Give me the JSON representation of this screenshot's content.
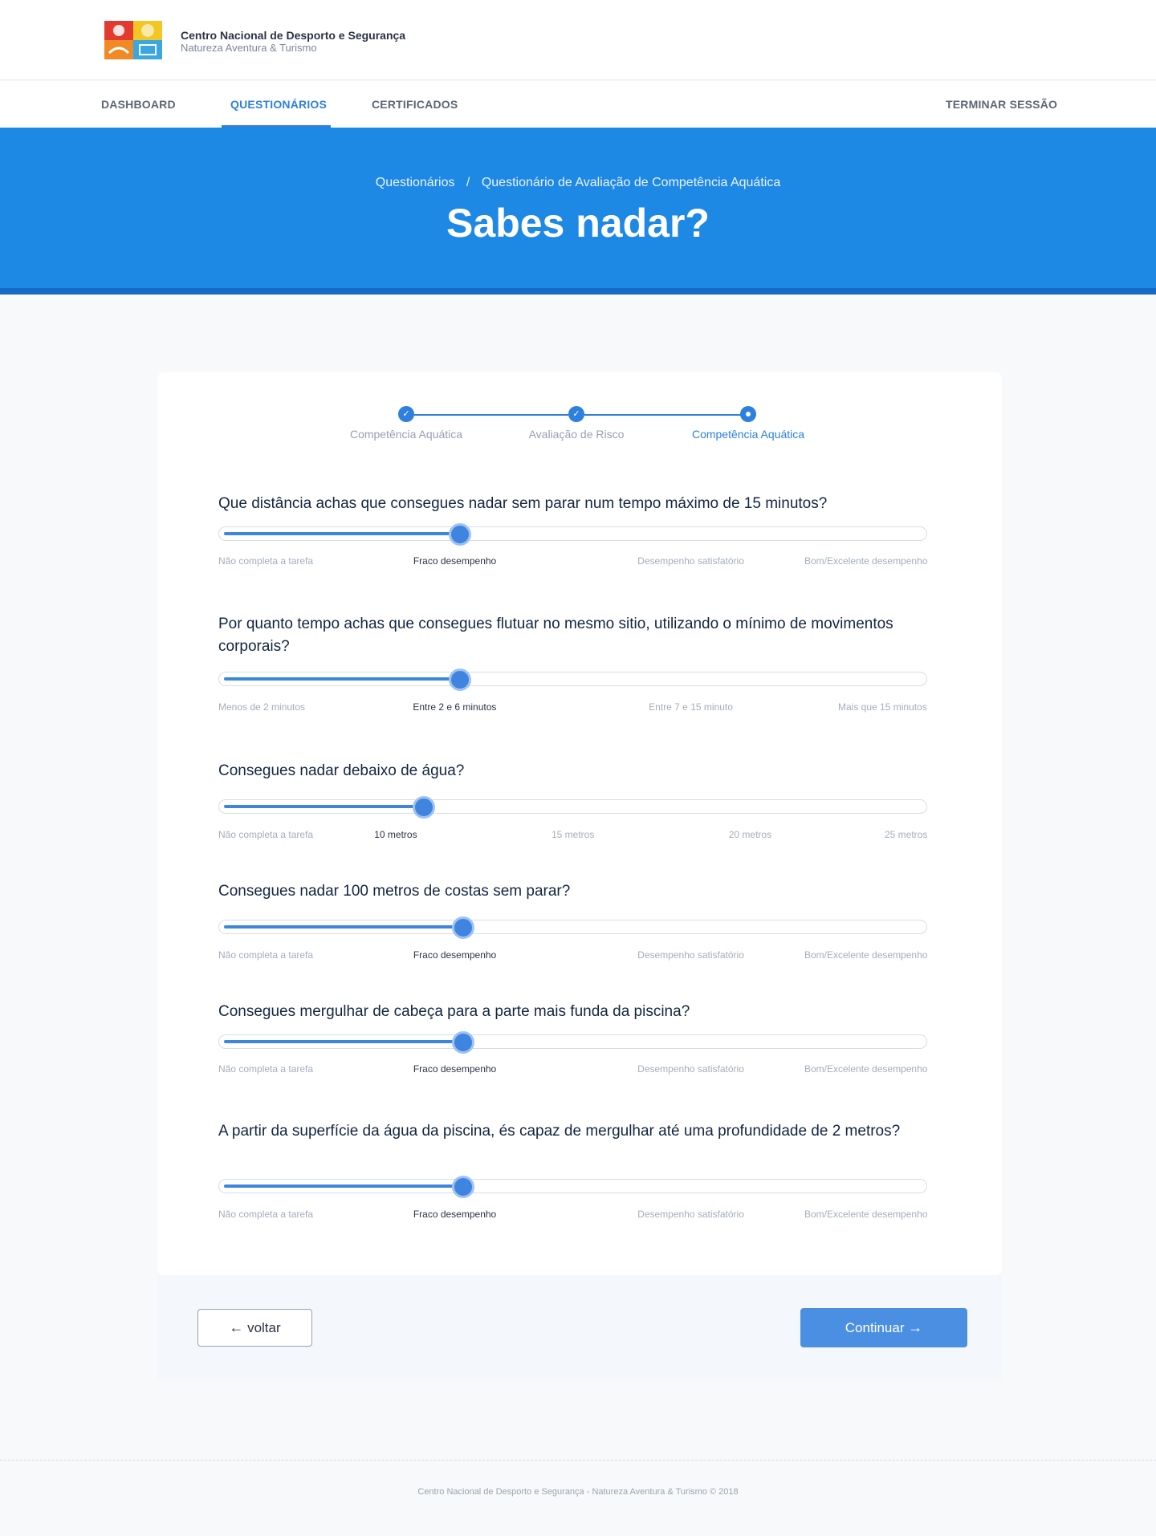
{
  "brand": {
    "name": "Centro Nacional de Desporto e Segurança",
    "subtitle": "Natureza Aventura & Turismo"
  },
  "nav": {
    "items": [
      {
        "label": "DASHBOARD",
        "active": false
      },
      {
        "label": "QUESTIONÁRIOS",
        "active": true
      },
      {
        "label": "CERTIFICADOS",
        "active": false
      }
    ],
    "logout": "TERMINAR SESSÃO"
  },
  "hero": {
    "breadcrumb": [
      "Questionários",
      "/",
      "Questionário de Avaliação de Competência Aquática"
    ],
    "title": "Sabes nadar?"
  },
  "stepper": [
    {
      "label": "Competência Aquática",
      "state": "done"
    },
    {
      "label": "Avaliação de Risco",
      "state": "done"
    },
    {
      "label": "Competência Aquática",
      "state": "current"
    }
  ],
  "questions": [
    {
      "text": "Que distância achas que consegues nadar sem parar num tempo máximo de 15 minutos?",
      "scale": [
        "Não completa a tarefa",
        "Fraco desempenho",
        "Desempenho satisfatório",
        "Bom/Excelente desempenho"
      ],
      "selected_index": 1,
      "value": 0.34
    },
    {
      "text": "Por quanto tempo achas que consegues flutuar no mesmo sitio, utilizando o mínimo de movimentos corporais?",
      "scale": [
        "Menos de 2 minutos",
        "Entre 2 e 6 minutos",
        "Entre 7 e 15 minuto",
        "Mais que 15 minutos"
      ],
      "selected_index": 1,
      "value": 0.34
    },
    {
      "text": "Consegues nadar debaixo de água?",
      "scale": [
        "Não completa a tarefa",
        "10 metros",
        "15 metros",
        "20 metros",
        "25 metros"
      ],
      "selected_index": 1,
      "value": 0.29
    },
    {
      "text": "Consegues nadar 100 metros de costas sem parar?",
      "scale": [
        "Não completa a tarefa",
        "Fraco desempenho",
        "Desempenho satisfatório",
        "Bom/Excelente desempenho"
      ],
      "selected_index": 1,
      "value": 0.345
    },
    {
      "text": "Consegues mergulhar de cabeça para a parte mais funda da piscina?",
      "scale": [
        "Não completa a tarefa",
        "Fraco desempenho",
        "Desempenho satisfatório",
        "Bom/Excelente desempenho"
      ],
      "selected_index": 1,
      "value": 0.345
    },
    {
      "text": "A partir da superfície da água da piscina, és capaz de mergulhar até uma profundidade de 2 metros?",
      "scale": [
        "Não completa a tarefa",
        "Fraco desempenho",
        "Desempenho satisfatório",
        "Bom/Excelente desempenho"
      ],
      "selected_index": 1,
      "value": 0.345
    }
  ],
  "actions": {
    "back_label": "voltar",
    "back_icon": "arrow-left-icon",
    "continue_label": "Continuar",
    "continue_icon": "arrow-right-icon"
  },
  "footer": {
    "text": "Centro Nacional de Desporto e Segurança - Natureza Aventura & Turismo © 2018"
  },
  "colors": {
    "primary": "#1e88e5",
    "accent": "#2d80dd",
    "text": "#12263f"
  }
}
